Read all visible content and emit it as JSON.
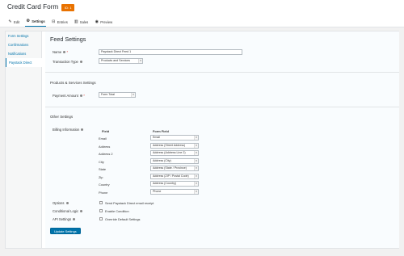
{
  "header": {
    "title": "Credit Card Form",
    "id_badge": "ID: 1"
  },
  "toolbar": {
    "items": [
      {
        "label": "Edit",
        "icon": "edit-icon"
      },
      {
        "label": "Settings",
        "icon": "gear-icon"
      },
      {
        "label": "Entries",
        "icon": "entries-icon"
      },
      {
        "label": "Sales",
        "icon": "chart-icon"
      },
      {
        "label": "Preview",
        "icon": "eye-icon"
      }
    ]
  },
  "sidebar": {
    "items": [
      {
        "label": "Form Settings"
      },
      {
        "label": "Confirmations"
      },
      {
        "label": "Notifications"
      },
      {
        "label": "Paystack Direct"
      }
    ]
  },
  "feed": {
    "title": "Feed Settings",
    "name_label": "Name",
    "name_value": "Paystack Direct Feed 1",
    "transaction_label": "Transaction Type",
    "transaction_value": "Products and Services"
  },
  "products": {
    "section_title": "Products & Services Settings",
    "payment_label": "Payment Amount",
    "payment_value": "Form Total"
  },
  "other": {
    "section_title": "Other Settings",
    "billing_label": "Billing Information",
    "field_header": "Field",
    "form_field_header": "Form Field",
    "rows": [
      {
        "field": "Email",
        "value": "Email"
      },
      {
        "field": "Address",
        "value": "Address (Street Address)"
      },
      {
        "field": "Address 2",
        "value": "Address (Address Line 2)"
      },
      {
        "field": "City",
        "value": "Address (City)"
      },
      {
        "field": "State",
        "value": "Address (State / Province)"
      },
      {
        "field": "Zip",
        "value": "Address (ZIP / Postal Code)"
      },
      {
        "field": "Country",
        "value": "Address (Country)"
      },
      {
        "field": "Phone",
        "value": "Phone"
      }
    ],
    "options_label": "Options",
    "options_check": "Send Paystack Direct email receipt",
    "conditional_label": "Conditional Logic",
    "conditional_check": "Enable Condition",
    "api_label": "API Settings",
    "api_check": "Override Default Settings"
  },
  "update_button": "Update Settings"
}
